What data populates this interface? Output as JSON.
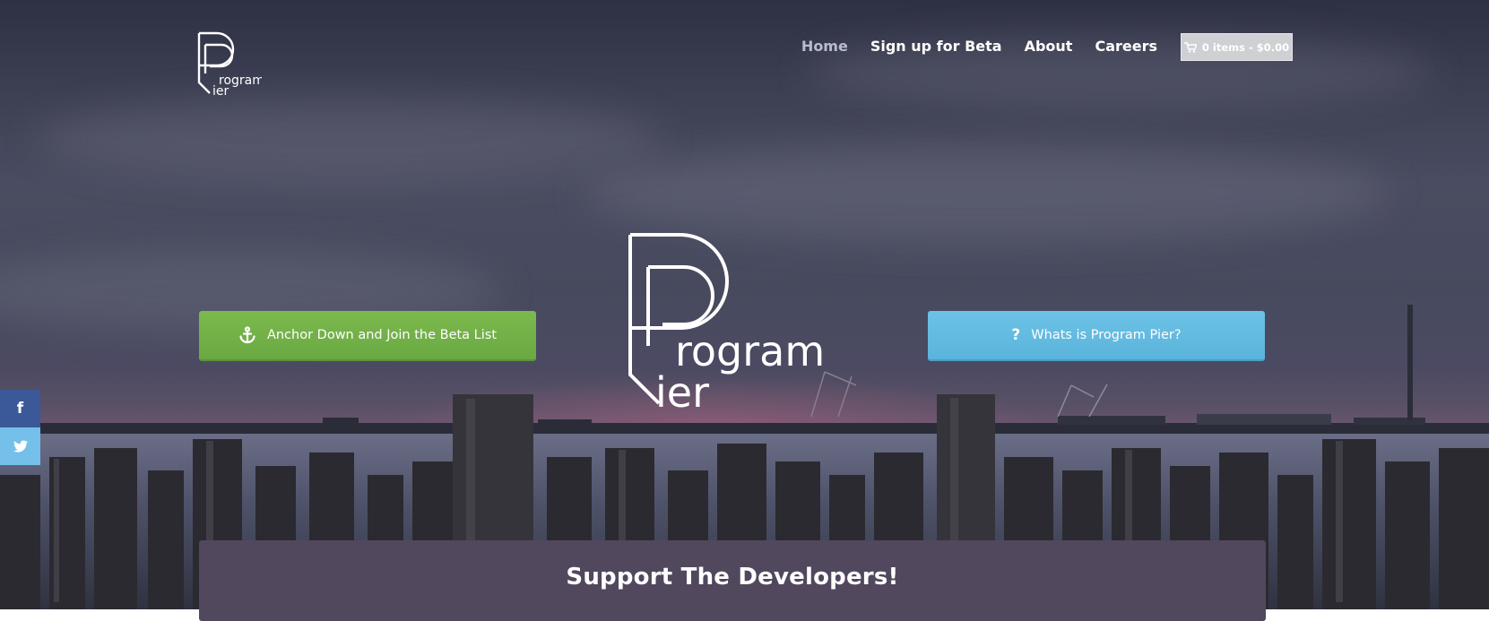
{
  "brand": {
    "logo_icon": "program-pier-logo",
    "logo_line1": "rogram",
    "logo_line2": "ier"
  },
  "nav": {
    "items": [
      {
        "label": "Home",
        "active": true
      },
      {
        "label": "Sign up for Beta",
        "active": false
      },
      {
        "label": "About",
        "active": false
      },
      {
        "label": "Careers",
        "active": false
      }
    ],
    "cart_icon": "shopping-cart-icon",
    "cart_label": "0 items - $0.00"
  },
  "hero": {
    "primary_button": {
      "icon": "anchor-icon",
      "label": "Anchor Down and Join the Beta List",
      "color": "#73b249"
    },
    "secondary_button": {
      "icon": "question-icon",
      "icon_glyph": "?",
      "label": "Whats is Program Pier?",
      "color": "#62bae0"
    }
  },
  "social": {
    "facebook": {
      "icon": "facebook-icon",
      "glyph": "f",
      "color": "#3b5998"
    },
    "twitter": {
      "icon": "twitter-icon",
      "color": "#74c0ea"
    }
  },
  "support": {
    "title": "Support The Developers!",
    "background": "#51485e"
  }
}
